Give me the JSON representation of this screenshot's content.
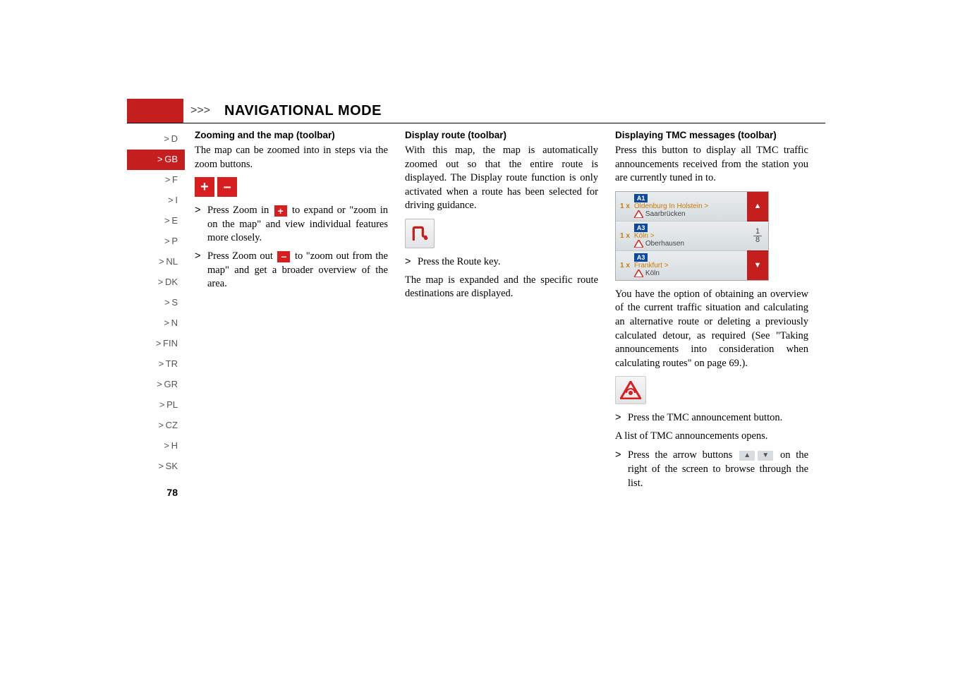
{
  "header": {
    "arrows": ">>>",
    "title": "NAVIGATIONAL MODE"
  },
  "sidebar": {
    "items": [
      {
        "label": "D"
      },
      {
        "label": "GB"
      },
      {
        "label": "F"
      },
      {
        "label": "I"
      },
      {
        "label": "E"
      },
      {
        "label": "P"
      },
      {
        "label": "NL"
      },
      {
        "label": "DK"
      },
      {
        "label": "S"
      },
      {
        "label": "N"
      },
      {
        "label": "FIN"
      },
      {
        "label": "TR"
      },
      {
        "label": "GR"
      },
      {
        "label": "PL"
      },
      {
        "label": "CZ"
      },
      {
        "label": "H"
      },
      {
        "label": "SK"
      }
    ],
    "arrow_glyph": ">",
    "highlight_index": 1,
    "page_number": "78"
  },
  "col1": {
    "heading": "Zooming and the map (toolbar)",
    "intro": "The map can be zoomed into in steps via the zoom buttons.",
    "zoom_plus": "+",
    "zoom_minus": "–",
    "b1_pre": "Press Zoom in ",
    "b1_post": " to expand or \"zoom in on the map\" and view individual features more closely.",
    "b2_pre": "Press Zoom out ",
    "b2_post": " to \"zoom out from the map\" and get a broader overview of the area."
  },
  "col2": {
    "heading": "Display route (toolbar)",
    "intro": "With this map, the map is automatically zoomed out so that the entire route is displayed. The Display route function is only activated when a route has been selected for driving guidance.",
    "b1": "Press the Route key.",
    "after": "The map is expanded and the specific route destinations are displayed."
  },
  "col3": {
    "heading": "Displaying TMC messages (toolbar)",
    "intro": "Press this button to display all TMC traffic announcements received from the station you are currently tuned in to.",
    "tmc": {
      "rows": [
        {
          "count": "1 x",
          "road": "A1",
          "top": "Oldenburg In Holstein >",
          "bot": "Saarbrücken"
        },
        {
          "count": "1 x",
          "road": "A3",
          "top": "Köln >",
          "bot": "Oberhausen"
        },
        {
          "count": "1 x",
          "road": "A3",
          "top": "Frankfurt >",
          "bot": "Köln"
        }
      ],
      "side_mid": "1\n8",
      "side_mid_top": "1",
      "side_mid_bot": "8",
      "up": "▲",
      "down": "▼"
    },
    "after1": "You have the option of obtaining an overview of the current traffic situation and calculating an alternative route or deleting a previously calculated detour, as required (See \"Taking announcements into consideration when calculating routes\" on page 69.).",
    "b1": "Press the TMC announcement button.",
    "line2": "A list of TMC announcements opens.",
    "b2_pre": "Press the arrow buttons ",
    "b2_post": " on the right of the screen to browse through the list."
  }
}
